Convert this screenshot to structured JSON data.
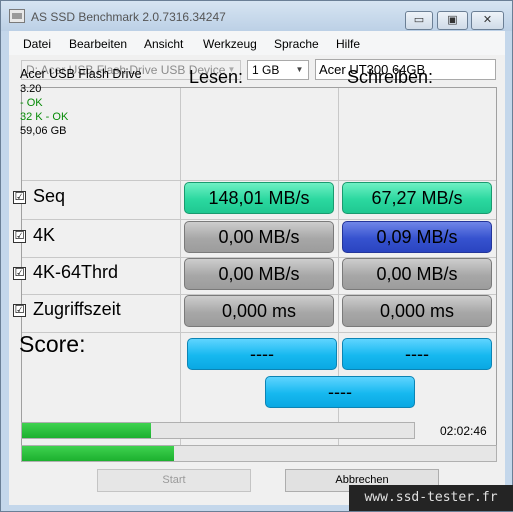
{
  "window": {
    "title": "AS SSD Benchmark 2.0.7316.34247",
    "controls": {
      "minimize": "▭",
      "maximize": "▣",
      "close": "✕"
    }
  },
  "menu": [
    "Datei",
    "Bearbeiten",
    "Ansicht",
    "Werkzeug",
    "Sprache",
    "Hilfe"
  ],
  "toolbar": {
    "drive_select": "D: Acer USB Flash Drive USB Device",
    "size_select": "1 GB",
    "drive_label": "Acer UT300 64GB"
  },
  "device": {
    "name": "Acer USB Flash Drive",
    "firmware": "3.20",
    "status1": " - OK",
    "status2": "32 K - OK",
    "capacity": "59,06 GB"
  },
  "headers": {
    "read": "Lesen:",
    "write": "Schreiben:"
  },
  "rows": [
    {
      "label": "Seq",
      "checked": "☑",
      "read": "148,01 MB/s",
      "write": "67,27 MB/s"
    },
    {
      "label": "4K",
      "checked": "☑",
      "read": "0,00 MB/s",
      "write": "0,09 MB/s"
    },
    {
      "label": "4K-64Thrd",
      "checked": "☑",
      "read": "0,00 MB/s",
      "write": "0,00 MB/s"
    },
    {
      "label": "Zugriffszeit",
      "checked": "☑",
      "read": "0,000 ms",
      "write": "0,000 ms"
    }
  ],
  "score": {
    "label": "Score:",
    "read": "----",
    "write": "----",
    "total": "----"
  },
  "progress": {
    "bar1_fraction": 0.33,
    "bar2_fraction": 0.32,
    "time": "02:02:46"
  },
  "buttons": {
    "start": "Start",
    "abort": "Abbrechen"
  },
  "watermark": "www.ssd-tester.fr",
  "colors": {
    "green": "#2bd89f",
    "blue": "#3652cf",
    "gray": "#a7a7a7",
    "cyan": "#16b8ef",
    "progress": "#1cb02f"
  }
}
